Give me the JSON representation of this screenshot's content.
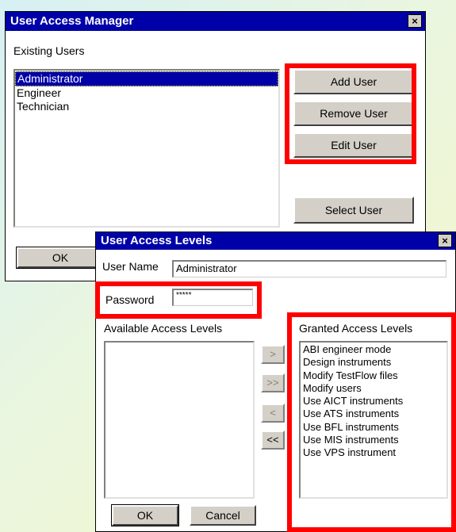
{
  "uam": {
    "title": "User Access Manager",
    "close": "×",
    "existing_users_label": "Existing Users",
    "users": [
      "Administrator",
      "Engineer",
      "Technician"
    ],
    "add_user": "Add User",
    "remove_user": "Remove User",
    "edit_user": "Edit User",
    "select_user": "Select User",
    "ok": "OK"
  },
  "ual": {
    "title": "User Access Levels",
    "close": "×",
    "user_name_label": "User Name",
    "user_name_value": "Administrator",
    "password_label": "Password",
    "password_value": "*****",
    "available_label": "Available Access Levels",
    "granted_label": "Granted Access Levels",
    "granted": [
      "ABI engineer mode",
      "Design instruments",
      "Modify TestFlow files",
      "Modify users",
      "Use AICT instruments",
      "Use ATS instruments",
      "Use BFL instruments",
      "Use MIS instruments",
      "Use VPS instrument"
    ],
    "add_one": ">",
    "add_all": ">>",
    "remove_one": "<",
    "remove_all": "<<",
    "ok": "OK",
    "cancel": "Cancel"
  },
  "colors": {
    "titlebar": "#0000a8",
    "highlight": "#ff0000",
    "button_face": "#d4d0c8"
  }
}
